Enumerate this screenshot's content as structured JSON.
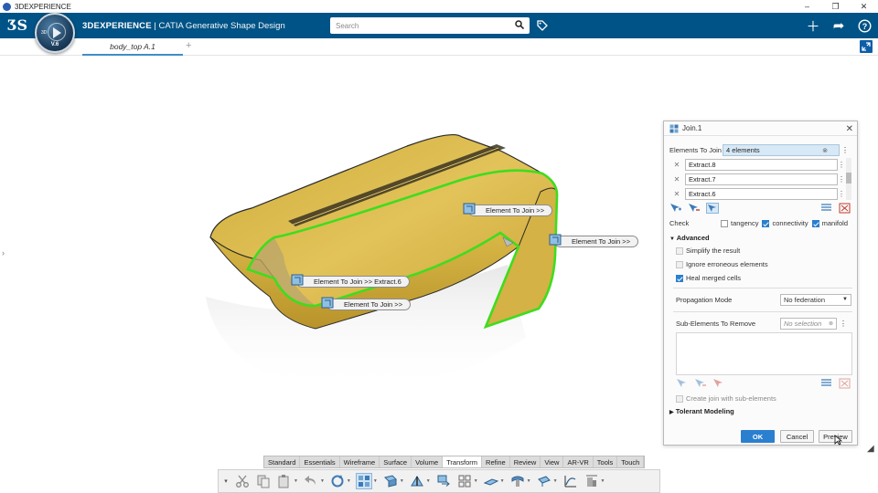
{
  "os": {
    "title": "3DEXPERIENCE",
    "buttons": [
      "–",
      "❐",
      "✕"
    ]
  },
  "header": {
    "brand_bold": "3DEXPERIENCE",
    "brand_sep": " | ",
    "brand_app": "CATIA Generative Shape Design",
    "compass_version": "V.6",
    "compass_3d": "3D",
    "search_placeholder": "Search",
    "icons": [
      "plus-icon",
      "share-icon",
      "help-icon"
    ]
  },
  "tabs": {
    "active": "body_top A.1",
    "add": "+"
  },
  "viewport": {
    "callouts": [
      {
        "text": "Element To Join >>"
      },
      {
        "text": "Element To Join >>"
      },
      {
        "text": "Element To Join >> Extract.6"
      },
      {
        "text": "Element To Join >>"
      }
    ]
  },
  "dialog": {
    "title": "Join.1",
    "elements_label": "Elements To Join",
    "elements_value": "4 elements",
    "list": [
      "Extract.8",
      "Extract.7",
      "Extract.6"
    ],
    "check_label": "Check",
    "check_tangency": "tangency",
    "check_connectivity": "connectivity",
    "check_manifold": "manifold",
    "checks": {
      "tangency": false,
      "connectivity": true,
      "manifold": true
    },
    "advanced_label": "Advanced",
    "simplify": "Simplify the result",
    "ignore": "Ignore erroneous elements",
    "heal": "Heal merged cells",
    "options": {
      "simplify": false,
      "ignore": false,
      "heal": true
    },
    "propagation_label": "Propagation Mode",
    "propagation_value": "No federation",
    "subelements_label": "Sub-Elements To Remove",
    "subelements_placeholder": "No selection",
    "create_join_label": "Create join with sub-elements",
    "tolerant_label": "Tolerant Modeling",
    "ok": "OK",
    "cancel": "Cancel",
    "preview": "Preview"
  },
  "action_bar": {
    "tabs": [
      "Standard",
      "Essentials",
      "Wireframe",
      "Surface",
      "Volume",
      "Transform",
      "Refine",
      "Review",
      "View",
      "AR-VR",
      "Tools",
      "Touch"
    ],
    "active": "Transform"
  },
  "colors": {
    "header": "#005386",
    "accent": "#2b7fcf",
    "surface": "#d8b840",
    "highlight": "#3fdc1f"
  }
}
